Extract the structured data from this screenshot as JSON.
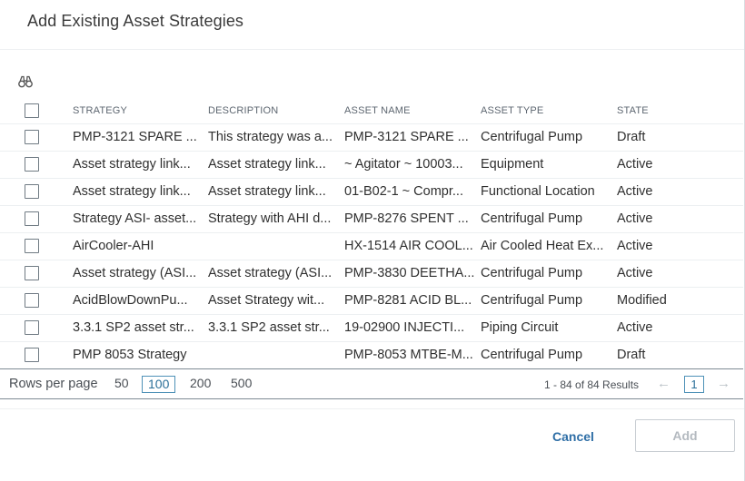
{
  "dialog": {
    "title": "Add Existing Asset Strategies"
  },
  "toolbar": {
    "search_icon": "binoculars-icon"
  },
  "grid": {
    "columns": [
      "STRATEGY",
      "DESCRIPTION",
      "ASSET NAME",
      "ASSET TYPE",
      "STATE"
    ],
    "rows": [
      {
        "strategy": "PMP-3121 SPARE ...",
        "description": "This strategy was a...",
        "asset_name": "PMP-3121 SPARE ...",
        "asset_type": "Centrifugal Pump",
        "state": "Draft"
      },
      {
        "strategy": "Asset strategy link...",
        "description": "Asset strategy link...",
        "asset_name": "~ Agitator ~ 10003...",
        "asset_type": "Equipment",
        "state": "Active"
      },
      {
        "strategy": "Asset strategy link...",
        "description": "Asset strategy link...",
        "asset_name": "01-B02-1 ~ Compr...",
        "asset_type": "Functional Location",
        "state": "Active"
      },
      {
        "strategy": "Strategy ASI- asset...",
        "description": "Strategy with AHI d...",
        "asset_name": "PMP-8276 SPENT ...",
        "asset_type": "Centrifugal Pump",
        "state": "Active"
      },
      {
        "strategy": "AirCooler-AHI",
        "description": "",
        "asset_name": "HX-1514 AIR COOL...",
        "asset_type": "Air Cooled Heat Ex...",
        "state": "Active"
      },
      {
        "strategy": "Asset strategy (ASI...",
        "description": "Asset strategy (ASI...",
        "asset_name": "PMP-3830 DEETHA...",
        "asset_type": "Centrifugal Pump",
        "state": "Active"
      },
      {
        "strategy": "AcidBlowDownPu...",
        "description": "Asset Strategy wit...",
        "asset_name": "PMP-8281 ACID BL...",
        "asset_type": "Centrifugal Pump",
        "state": "Modified"
      },
      {
        "strategy": "3.3.1 SP2 asset str...",
        "description": "3.3.1 SP2 asset str...",
        "asset_name": "19-02900 INJECTI...",
        "asset_type": "Piping Circuit",
        "state": "Active"
      },
      {
        "strategy": "PMP 8053 Strategy",
        "description": "",
        "asset_name": "PMP-8053 MTBE-M...",
        "asset_type": "Centrifugal Pump",
        "state": "Draft"
      }
    ]
  },
  "pager": {
    "rows_label": "Rows per page",
    "sizes": [
      "50",
      "100",
      "200",
      "500"
    ],
    "selected_size": "100",
    "results": "1 - 84 of 84 Results",
    "page": "1",
    "prev_icon": "arrow-left-icon",
    "next_icon": "arrow-right-icon"
  },
  "footer": {
    "cancel_label": "Cancel",
    "add_label": "Add"
  },
  "colors": {
    "accent": "#2e6ea6",
    "selected_border": "#4e91b7",
    "disabled_text": "#b4bac0"
  }
}
